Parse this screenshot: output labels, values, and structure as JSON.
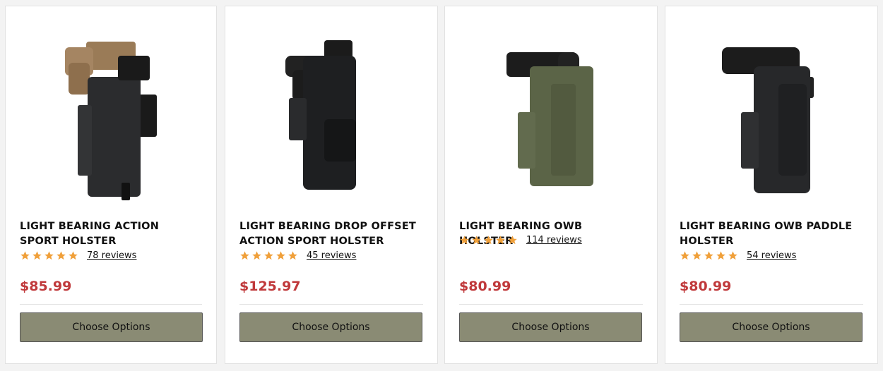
{
  "products": [
    {
      "title": "LIGHT BEARING ACTION SPORT HOLSTER",
      "reviews": "78 reviews",
      "price": "$85.99",
      "button": "Choose Options",
      "rating": 5,
      "holster_color": "#2b2c2e",
      "gun_color": "#9a7b57"
    },
    {
      "title": "LIGHT BEARING DROP OFFSET ACTION SPORT HOLSTER",
      "reviews": "45 reviews",
      "price": "$125.97",
      "button": "Choose Options",
      "rating": 5,
      "holster_color": "#1e1f21",
      "gun_color": "#1b1b1b"
    },
    {
      "title": "LIGHT BEARING OWB HOLSTER",
      "reviews": "114 reviews",
      "price": "$80.99",
      "button": "Choose Options",
      "rating": 5,
      "holster_color": "#5b6447",
      "gun_color": "#1c1c1c"
    },
    {
      "title": "LIGHT BEARING OWB PADDLE HOLSTER",
      "reviews": "54 reviews",
      "price": "$80.99",
      "button": "Choose Options",
      "rating": 5,
      "holster_color": "#27282a",
      "gun_color": "#1c1c1c"
    }
  ],
  "star_color": "#f0a03a"
}
